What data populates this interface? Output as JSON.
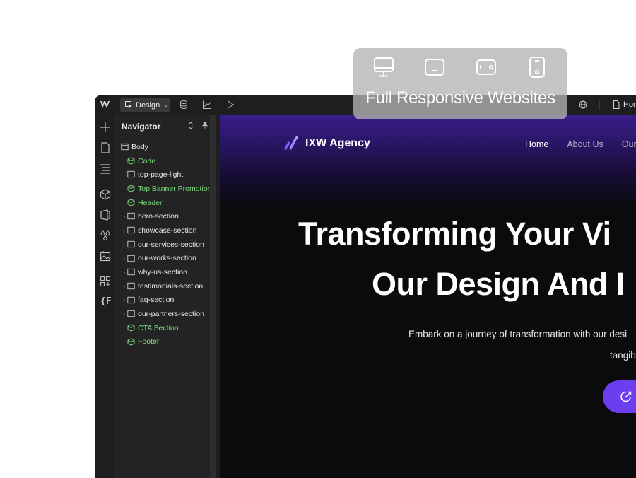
{
  "topbar": {
    "mode_label": "Design",
    "page_label": "Hom"
  },
  "navigator": {
    "title": "Navigator",
    "items": [
      {
        "label": "Body",
        "type": "element",
        "caret": false,
        "indent": 0
      },
      {
        "label": "Code",
        "type": "component",
        "caret": false,
        "indent": 1
      },
      {
        "label": "top-page-light",
        "type": "element",
        "caret": false,
        "indent": 1
      },
      {
        "label": "Top Banner Promotion",
        "type": "component",
        "caret": false,
        "indent": 1
      },
      {
        "label": "Header",
        "type": "component",
        "caret": false,
        "indent": 1
      },
      {
        "label": "hero-section",
        "type": "element",
        "caret": true,
        "indent": 1
      },
      {
        "label": "showcase-section",
        "type": "element",
        "caret": true,
        "indent": 1
      },
      {
        "label": "our-services-section",
        "type": "element",
        "caret": true,
        "indent": 1
      },
      {
        "label": "our-works-section",
        "type": "element",
        "caret": true,
        "indent": 1
      },
      {
        "label": "why-us-section",
        "type": "element",
        "caret": true,
        "indent": 1
      },
      {
        "label": "testimonials-section",
        "type": "element",
        "caret": true,
        "indent": 1
      },
      {
        "label": "faq-section",
        "type": "element",
        "caret": true,
        "indent": 1
      },
      {
        "label": "our-partners-section",
        "type": "element",
        "caret": true,
        "indent": 1
      },
      {
        "label": "CTA Section",
        "type": "component",
        "caret": false,
        "indent": 1
      },
      {
        "label": "Footer",
        "type": "component",
        "caret": false,
        "indent": 1
      }
    ]
  },
  "rail": {
    "variables_label": "{F"
  },
  "site": {
    "brand": "IXW Agency",
    "nav": {
      "home": "Home",
      "about": "About Us",
      "our": "Our"
    },
    "hero_line1": "Transforming Your Vi",
    "hero_line2": "Our Design And I",
    "sub_line1": "Embark on a journey of transformation with our desi",
    "sub_line2": "tangib"
  },
  "overlay": {
    "title": "Full Responsive Websites"
  },
  "colors": {
    "accent": "#6d3df2",
    "component_green": "#7ee07e",
    "panel_bg": "#1e1e1e"
  }
}
